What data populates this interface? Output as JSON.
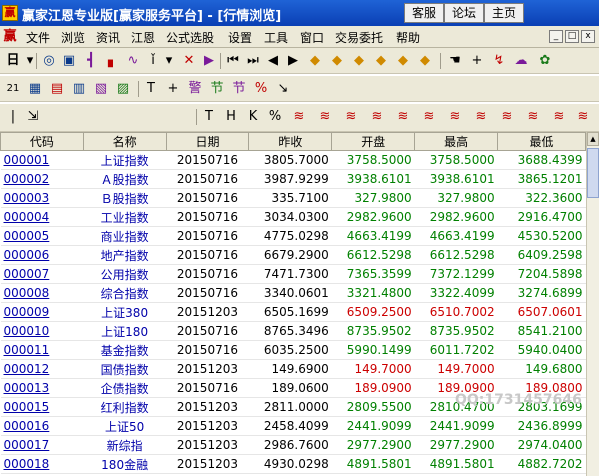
{
  "window": {
    "title": "赢家江恩专业版[赢家服务平台] - [行情浏览]",
    "buttons": [
      "客服",
      "论坛",
      "主页"
    ]
  },
  "menu": {
    "logo": "赢",
    "items": [
      "文件",
      "浏览",
      "资讯",
      "江恩",
      "公式选股",
      "设置",
      "工具",
      "窗口",
      "交易委托",
      "帮助"
    ],
    "controls": [
      "_",
      "□",
      "x"
    ]
  },
  "toolbar1": {
    "icons": [
      "calendar-icon",
      "globe-icon",
      "document-icon",
      "candlestick-icon",
      "bar-chart-icon",
      "line-chart-icon",
      "index-icon",
      "pointer-icon",
      "grid-icon",
      "flag-icon",
      "first-icon",
      "prev-icon",
      "back-icon",
      "forward-icon",
      "diamond-up-icon",
      "diamond-right-icon",
      "diamond-left-icon",
      "diamond-down-icon",
      "diamond-cross-icon",
      "diamond-star-icon",
      "hand-icon",
      "crosshair-icon",
      "trend-icon",
      "cloud-icon",
      "monitor-icon"
    ]
  },
  "toolbar2": {
    "glyphs": [
      "21",
      "▦",
      "▤",
      "▥",
      "▧",
      "▨",
      "T",
      "+",
      "警",
      "节",
      "节",
      "%",
      "↘"
    ]
  },
  "toolbar3": {
    "glyphs": [
      "T",
      "H",
      "K",
      "%",
      "≋",
      "≋",
      "≋",
      "≋",
      "≋",
      "≋",
      "≋",
      "≋",
      "≋",
      "≋",
      "≋",
      "≋",
      "≋",
      "≋"
    ]
  },
  "table": {
    "columns": [
      "代码",
      "名称",
      "日期",
      "昨收",
      "开盘",
      "最高",
      "最低"
    ],
    "rows": [
      [
        "000001",
        "上证指数",
        "20150716",
        "3805.7000",
        "3758.5000",
        "3758.5000",
        "3688.4399"
      ],
      [
        "000002",
        "Ａ股指数",
        "20150716",
        "3987.9299",
        "3938.6101",
        "3938.6101",
        "3865.1201"
      ],
      [
        "000003",
        "Ｂ股指数",
        "20150716",
        "335.7100",
        "327.9800",
        "327.9800",
        "322.3600"
      ],
      [
        "000004",
        "工业指数",
        "20150716",
        "3034.0300",
        "2982.9600",
        "2982.9600",
        "2916.4700"
      ],
      [
        "000005",
        "商业指数",
        "20150716",
        "4775.0298",
        "4663.4199",
        "4663.4199",
        "4530.5200"
      ],
      [
        "000006",
        "地产指数",
        "20150716",
        "6679.2900",
        "6612.5298",
        "6612.5298",
        "6409.2598"
      ],
      [
        "000007",
        "公用指数",
        "20150716",
        "7471.7300",
        "7365.3599",
        "7372.1299",
        "7204.5898"
      ],
      [
        "000008",
        "综合指数",
        "20150716",
        "3340.0601",
        "3321.4800",
        "3322.4099",
        "3274.6899"
      ],
      [
        "000009",
        "上证380",
        "20151203",
        "6505.1699",
        "6509.2500",
        "6510.7002",
        "6507.0601"
      ],
      [
        "000010",
        "上证180",
        "20150716",
        "8765.3496",
        "8735.9502",
        "8735.9502",
        "8541.2100"
      ],
      [
        "000011",
        "基金指数",
        "20150716",
        "6035.2500",
        "5990.1499",
        "6011.7202",
        "5940.0400"
      ],
      [
        "000012",
        "国债指数",
        "20151203",
        "149.6900",
        "149.7000",
        "149.7000",
        "149.6800"
      ],
      [
        "000013",
        "企债指数",
        "20150716",
        "189.0600",
        "189.0900",
        "189.0900",
        "189.0800"
      ],
      [
        "000015",
        "红利指数",
        "20151203",
        "2811.0000",
        "2809.5500",
        "2810.4700",
        "2803.1699"
      ],
      [
        "000016",
        "上证50",
        "20151203",
        "2458.4099",
        "2441.9099",
        "2441.9099",
        "2436.8999"
      ],
      [
        "000017",
        "新综指",
        "20151203",
        "2986.7600",
        "2977.2900",
        "2977.2900",
        "2974.0400"
      ],
      [
        "000018",
        "180金融",
        "20151203",
        "4930.0298",
        "4891.5801",
        "4891.5801",
        "4882.7202"
      ]
    ]
  },
  "watermark": "QQ:1731457646"
}
